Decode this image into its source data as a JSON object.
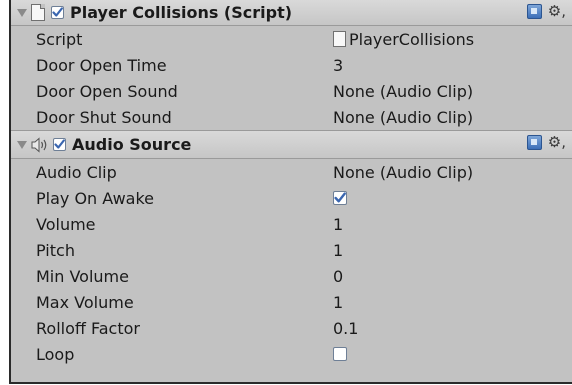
{
  "player_collisions": {
    "title": "Player Collisions (Script)",
    "enabled": true,
    "fields": [
      {
        "label": "Script",
        "value": "PlayerCollisions",
        "kind": "object-file"
      },
      {
        "label": "Door Open Time",
        "value": "3",
        "kind": "number"
      },
      {
        "label": "Door Open Sound",
        "value": "None (Audio Clip)",
        "kind": "object"
      },
      {
        "label": "Door Shut Sound",
        "value": "None (Audio Clip)",
        "kind": "object"
      }
    ]
  },
  "audio_source": {
    "title": "Audio Source",
    "enabled": true,
    "fields": [
      {
        "label": "Audio Clip",
        "value": "None (Audio Clip)",
        "kind": "object"
      },
      {
        "label": "Play On Awake",
        "checked": true,
        "kind": "toggle"
      },
      {
        "label": "Volume",
        "value": "1",
        "kind": "number"
      },
      {
        "label": "Pitch",
        "value": "1",
        "kind": "number"
      },
      {
        "label": "Min Volume",
        "value": "0",
        "kind": "number"
      },
      {
        "label": "Max Volume",
        "value": "1",
        "kind": "number"
      },
      {
        "label": "Rolloff Factor",
        "value": "0.1",
        "kind": "number"
      },
      {
        "label": "Loop",
        "checked": false,
        "kind": "toggle"
      }
    ]
  },
  "icons": {
    "foldout": "foldout-arrow-icon",
    "script": "script-file-icon",
    "audio": "speaker-icon",
    "help": "help-book-icon",
    "settings": "gear-icon"
  },
  "colors": {
    "panel_bg": "#c2c2c2",
    "checkbox_border": "#6e7f96",
    "checkmark": "#3a66b0",
    "help_icon": "#3c6fb8"
  }
}
